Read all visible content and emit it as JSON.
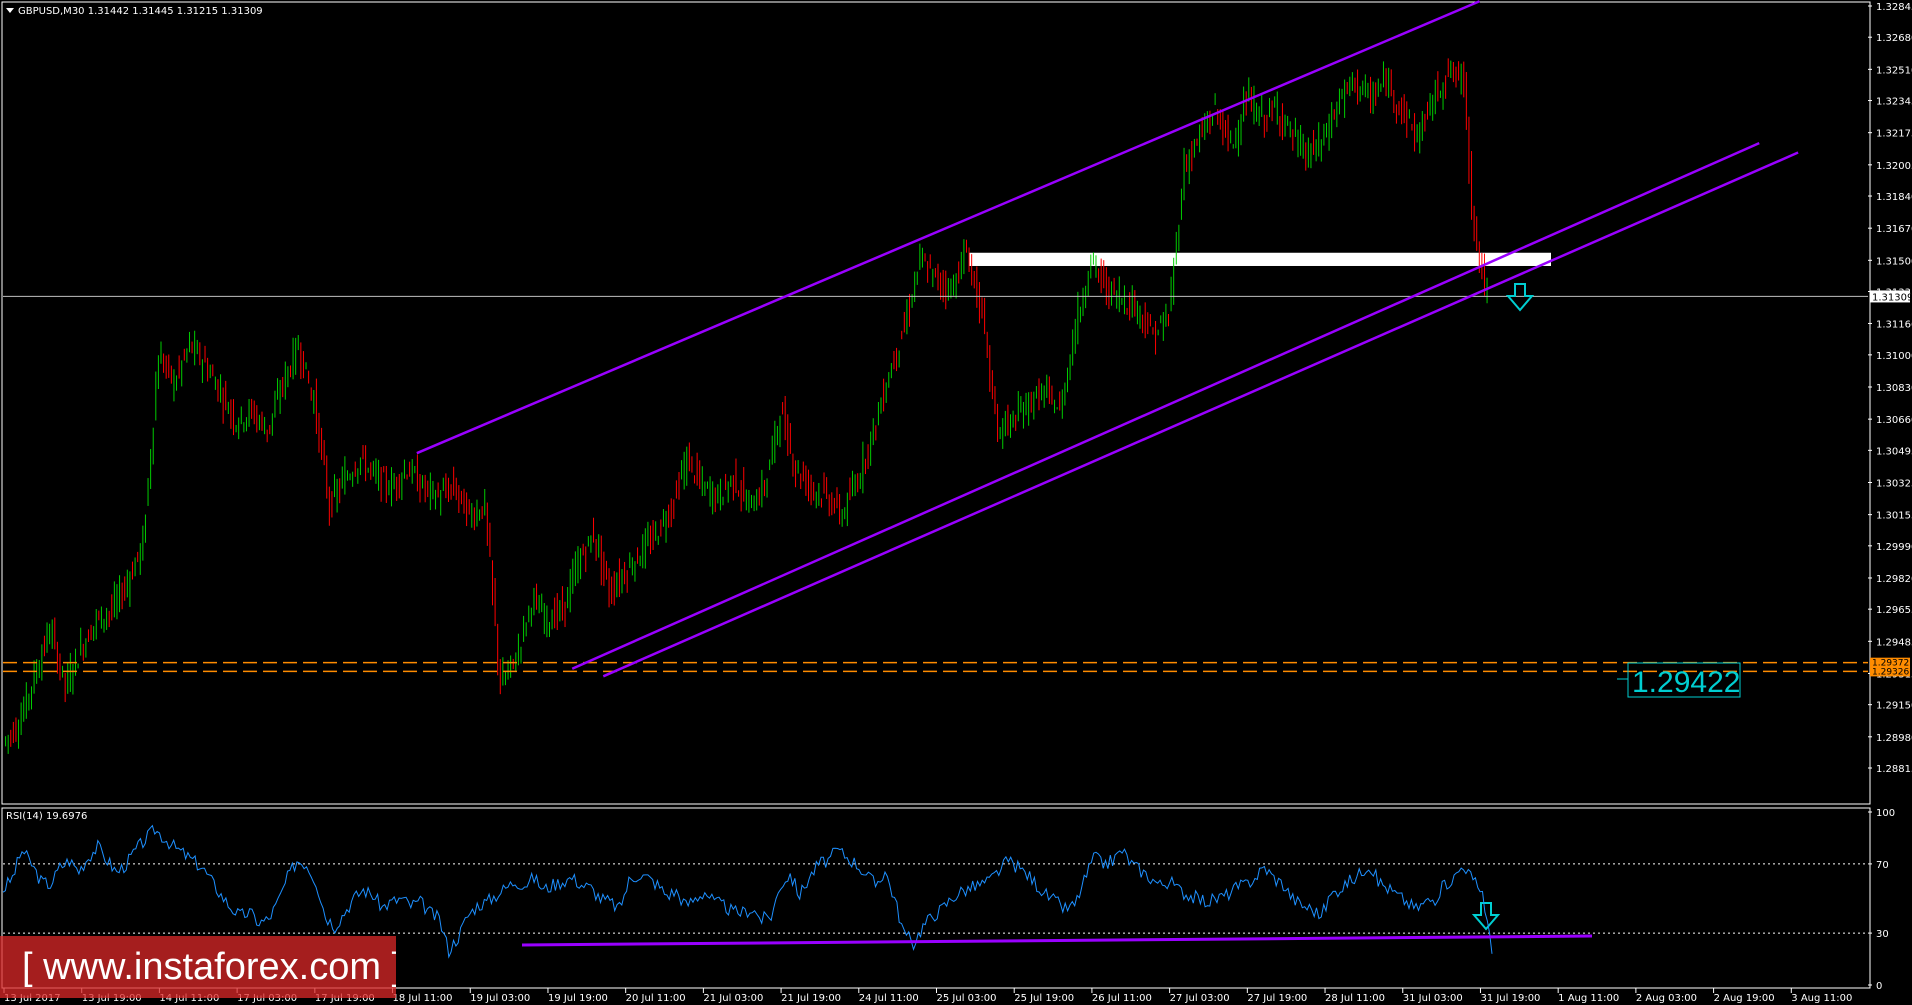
{
  "chart_data": [
    {
      "type": "candlestick",
      "symbol_header": "GBPUSD,M30  1.31442 1.31445 1.31215 1.31309",
      "y_ticks": [
        "1.32845",
        "1.32680",
        "1.32510",
        "1.32345",
        "1.32175",
        "1.32005",
        "1.31840",
        "1.31670",
        "1.31500",
        "1.31335",
        "1.31166",
        "1.31000",
        "1.30830",
        "1.30660",
        "1.30495",
        "1.30325",
        "1.30155",
        "1.29990",
        "1.29820",
        "1.29655",
        "1.29485",
        "1.29315",
        "1.29150",
        "1.28980",
        "1.28815"
      ],
      "ylim": [
        1.28815,
        1.32845
      ],
      "x_ticks": [
        "13 Jul 2017",
        "13 Jul 19:00",
        "14 Jul 11:00",
        "17 Jul 03:00",
        "17 Jul 19:00",
        "18 Jul 11:00",
        "19 Jul 03:00",
        "19 Jul 19:00",
        "20 Jul 11:00",
        "21 Jul 03:00",
        "21 Jul 19:00",
        "24 Jul 11:00",
        "25 Jul 03:00",
        "25 Jul 19:00",
        "26 Jul 11:00",
        "27 Jul 03:00",
        "27 Jul 19:00",
        "28 Jul 11:00",
        "31 Jul 03:00",
        "31 Jul 19:00",
        "1 Aug 11:00",
        "2 Aug 03:00",
        "2 Aug 19:00",
        "3 Aug 11:00"
      ],
      "current_price_label": "1.31309",
      "current_price": 1.31309,
      "support_lines": [
        {
          "price": 1.29372,
          "label": "1.29372"
        },
        {
          "price": 1.29326,
          "label": "1.29326"
        }
      ],
      "target_label": "1.29422",
      "resistance_zone": {
        "low": 1.3147,
        "high": 1.3154
      },
      "price_path": [
        [
          0,
          1.2895
        ],
        [
          2,
          1.2905
        ],
        [
          4,
          1.293
        ],
        [
          6,
          1.2955
        ],
        [
          8,
          1.2925
        ],
        [
          10,
          1.2945
        ],
        [
          12,
          1.296
        ],
        [
          14,
          1.2965
        ],
        [
          16,
          1.298
        ],
        [
          18,
          1.3
        ],
        [
          20,
          1.31
        ],
        [
          22,
          1.3085
        ],
        [
          24,
          1.3105
        ],
        [
          26,
          1.3095
        ],
        [
          28,
          1.308
        ],
        [
          30,
          1.3065
        ],
        [
          32,
          1.307
        ],
        [
          34,
          1.306
        ],
        [
          36,
          1.3085
        ],
        [
          38,
          1.3105
        ],
        [
          40,
          1.3075
        ],
        [
          42,
          1.302
        ],
        [
          44,
          1.3035
        ],
        [
          46,
          1.3045
        ],
        [
          48,
          1.3035
        ],
        [
          50,
          1.303
        ],
        [
          52,
          1.304
        ],
        [
          54,
          1.303
        ],
        [
          56,
          1.3025
        ],
        [
          58,
          1.303
        ],
        [
          60,
          1.3015
        ],
        [
          62,
          1.302
        ],
        [
          64,
          1.2925
        ],
        [
          66,
          1.294
        ],
        [
          68,
          1.297
        ],
        [
          70,
          1.296
        ],
        [
          72,
          1.2965
        ],
        [
          74,
          1.299
        ],
        [
          76,
          1.3005
        ],
        [
          78,
          1.2975
        ],
        [
          80,
          1.2985
        ],
        [
          82,
          1.2995
        ],
        [
          84,
          1.3005
        ],
        [
          86,
          1.302
        ],
        [
          88,
          1.3045
        ],
        [
          90,
          1.303
        ],
        [
          92,
          1.3025
        ],
        [
          94,
          1.3035
        ],
        [
          96,
          1.302
        ],
        [
          98,
          1.303
        ],
        [
          100,
          1.307
        ],
        [
          102,
          1.304
        ],
        [
          104,
          1.303
        ],
        [
          106,
          1.3025
        ],
        [
          108,
          1.3015
        ],
        [
          110,
          1.3035
        ],
        [
          112,
          1.306
        ],
        [
          114,
          1.309
        ],
        [
          116,
          1.3115
        ],
        [
          118,
          1.315
        ],
        [
          120,
          1.314
        ],
        [
          122,
          1.3135
        ],
        [
          124,
          1.3155
        ],
        [
          126,
          1.312
        ],
        [
          128,
          1.306
        ],
        [
          130,
          1.3065
        ],
        [
          132,
          1.3075
        ],
        [
          134,
          1.308
        ],
        [
          136,
          1.307
        ],
        [
          138,
          1.3115
        ],
        [
          140,
          1.315
        ],
        [
          142,
          1.3135
        ],
        [
          144,
          1.313
        ],
        [
          146,
          1.3125
        ],
        [
          148,
          1.311
        ],
        [
          150,
          1.312
        ],
        [
          152,
          1.32
        ],
        [
          154,
          1.3215
        ],
        [
          156,
          1.323
        ],
        [
          158,
          1.321
        ],
        [
          160,
          1.3235
        ],
        [
          162,
          1.3225
        ],
        [
          164,
          1.323
        ],
        [
          166,
          1.3215
        ],
        [
          168,
          1.3205
        ],
        [
          170,
          1.3215
        ],
        [
          172,
          1.3235
        ],
        [
          174,
          1.3245
        ],
        [
          176,
          1.3235
        ],
        [
          178,
          1.3245
        ],
        [
          180,
          1.323
        ],
        [
          182,
          1.3215
        ],
        [
          184,
          1.3235
        ],
        [
          186,
          1.325
        ],
        [
          188,
          1.3245
        ],
        [
          189,
          1.318
        ],
        [
          190,
          1.315
        ],
        [
          191,
          1.3131
        ]
      ],
      "trend_lines": [
        {
          "from": [
            40,
            1.3048
          ],
          "to": [
            176,
            1.3287
          ]
        },
        {
          "from": [
            60,
            1.2934
          ],
          "to": [
            212,
            1.3212
          ]
        },
        {
          "from": [
            64,
            1.293
          ],
          "to": [
            217,
            1.3207
          ]
        }
      ]
    },
    {
      "type": "line",
      "indicator_header": "RSI(14) 19.6976",
      "y_ticks": [
        "100",
        "70",
        "30",
        "0"
      ],
      "ylim": [
        0,
        100
      ],
      "levels": [
        70,
        30
      ],
      "values": [
        55,
        62,
        78,
        70,
        60,
        58,
        68,
        72,
        66,
        74,
        80,
        72,
        65,
        70,
        78,
        84,
        90,
        85,
        80,
        76,
        72,
        68,
        60,
        52,
        45,
        40,
        42,
        36,
        38,
        48,
        62,
        72,
        70,
        60,
        40,
        34,
        42,
        50,
        55,
        52,
        45,
        48,
        50,
        46,
        48,
        42,
        38,
        20,
        28,
        40,
        46,
        48,
        52,
        56,
        60,
        58,
        62,
        55,
        58,
        60,
        62,
        58,
        56,
        50,
        48,
        44,
        60,
        64,
        62,
        58,
        52,
        54,
        46,
        50,
        54,
        48,
        46,
        42,
        42,
        44,
        38,
        40,
        58,
        64,
        52,
        62,
        70,
        72,
        78,
        74,
        70,
        64,
        58,
        66,
        50,
        30,
        24,
        34,
        40,
        44,
        50,
        54,
        56,
        58,
        60,
        66,
        72,
        68,
        64,
        58,
        52,
        48,
        44,
        46,
        60,
        74,
        70,
        72,
        78,
        70,
        66,
        62,
        58,
        60,
        55,
        52,
        50,
        48,
        50,
        52,
        56,
        58,
        62,
        68,
        62,
        58,
        50,
        46,
        44,
        40,
        52,
        56,
        60,
        64,
        70,
        60,
        56,
        52,
        48,
        44,
        48,
        50,
        58,
        62,
        70,
        60,
        54,
        18
      ],
      "support_trendline": {
        "from": [
          0,
          22
        ],
        "to": [
          1,
          26
        ]
      }
    }
  ],
  "watermark": {
    "bracket_open": "[",
    "site": "www.instaforex.com",
    "bracket_close": "]"
  },
  "colors": {
    "bull": "#00cc00",
    "bear": "#ff0000",
    "channel": "#9900ff",
    "rsi": "#1e90ff",
    "support": "#ff8c00",
    "zone": "#ffffff",
    "arrow": "#00ced1"
  }
}
